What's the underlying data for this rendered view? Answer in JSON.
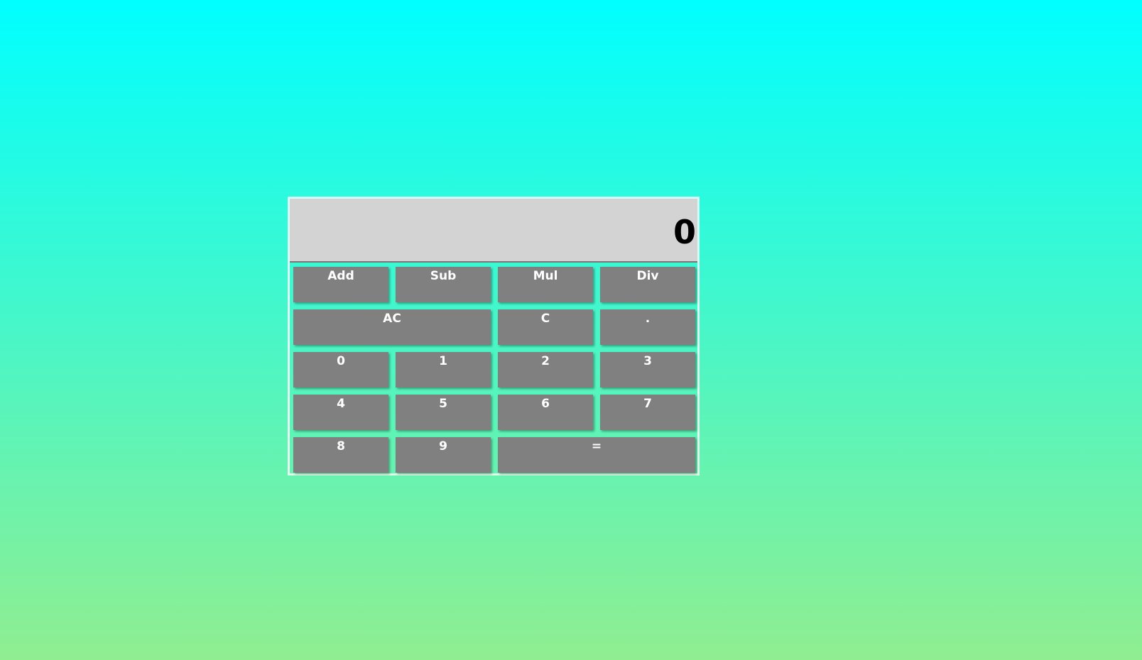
{
  "display": {
    "value": "0"
  },
  "operations": {
    "add": "Add",
    "sub": "Sub",
    "mul": "Mul",
    "div": "Div"
  },
  "controls": {
    "all_clear": "AC",
    "clear": "C",
    "decimal": ".",
    "equals": "="
  },
  "digits": [
    "0",
    "1",
    "2",
    "3",
    "4",
    "5",
    "6",
    "7",
    "8",
    "9"
  ],
  "colors": {
    "background_top": "#00ffff",
    "background_bottom": "#90ee90",
    "display_bg": "#d3d3d3",
    "key_bg": "#808080",
    "key_text": "#ffffff"
  }
}
